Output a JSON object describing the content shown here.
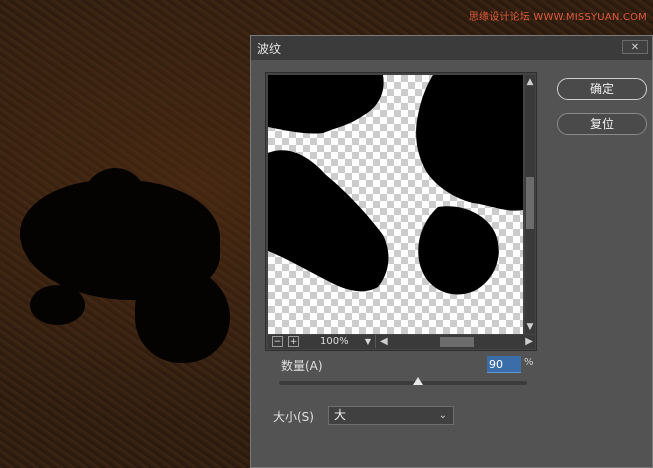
{
  "watermark": {
    "url_text": "思缘设计论坛 WWW.MISSYUAN.COM"
  },
  "dialog": {
    "title": "波纹",
    "close_icon": "close-icon"
  },
  "preview": {
    "zoom_out_label": "−",
    "zoom_in_label": "+",
    "zoom_value": "100%"
  },
  "buttons": {
    "ok": "确定",
    "reset": "复位"
  },
  "amount": {
    "label": "数量(A)",
    "value": "90",
    "unit": "%",
    "slider_fraction": 0.56
  },
  "size": {
    "label": "大小(S)",
    "selected": "大"
  },
  "colors": {
    "dialog_bg": "#535353",
    "titlebar_bg": "#3b3b3b",
    "accent_blue": "#5a9bd5",
    "watermark_red": "#e25b3d"
  }
}
